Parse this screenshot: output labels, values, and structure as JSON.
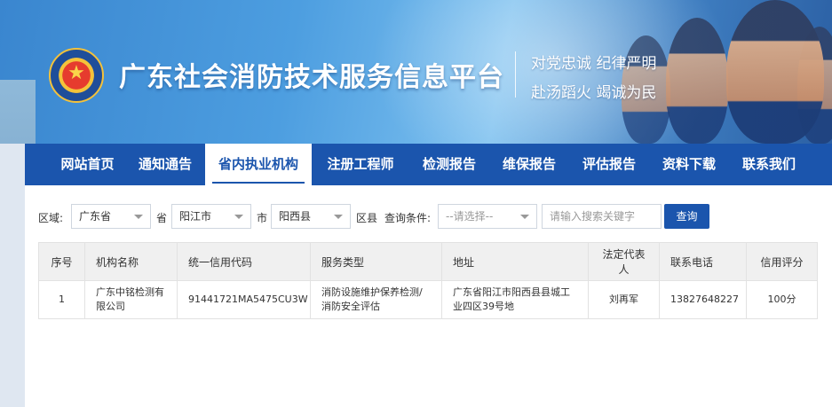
{
  "header": {
    "site_title": "广东社会消防技术服务信息平台",
    "slogan_line1": "对党忠诚 纪律严明",
    "slogan_line2": "赴汤蹈火 竭诚为民"
  },
  "nav": {
    "items": [
      {
        "label": "网站首页",
        "active": false
      },
      {
        "label": "通知通告",
        "active": false
      },
      {
        "label": "省内执业机构",
        "active": true
      },
      {
        "label": "注册工程师",
        "active": false
      },
      {
        "label": "检测报告",
        "active": false
      },
      {
        "label": "维保报告",
        "active": false
      },
      {
        "label": "评估报告",
        "active": false
      },
      {
        "label": "资料下载",
        "active": false
      },
      {
        "label": "联系我们",
        "active": false
      }
    ]
  },
  "filters": {
    "region_label": "区域:",
    "province_value": "广东省",
    "province_suffix": "省",
    "city_value": "阳江市",
    "city_suffix": "市",
    "county_value": "阳西县",
    "county_suffix": "区县",
    "condition_label": "查询条件:",
    "condition_value": "--请选择--",
    "search_placeholder": "请输入搜索关键字",
    "search_button": "查询"
  },
  "table": {
    "headers": [
      "序号",
      "机构名称",
      "统一信用代码",
      "服务类型",
      "地址",
      "法定代表人",
      "联系电话",
      "信用评分"
    ],
    "rows": [
      {
        "index": "1",
        "name": "广东中铭检测有限公司",
        "credit_code": "91441721MA5475CU3W",
        "service_type": "消防设施维护保养检测/消防安全评估",
        "address": "广东省阳江市阳西县县城工业四区39号地",
        "legal_rep": "刘再军",
        "phone": "13827648227",
        "score": "100分"
      }
    ]
  },
  "colors": {
    "nav_bg": "#1b55ad",
    "banner_blue": "#4d9ee0",
    "button_bg": "#1b55ad"
  }
}
